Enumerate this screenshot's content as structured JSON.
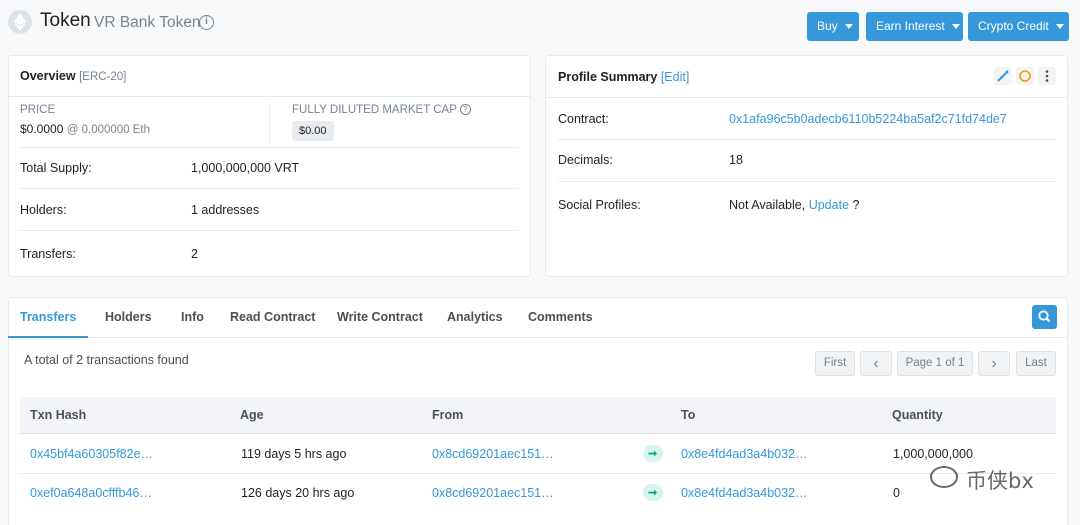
{
  "header": {
    "title": "Token",
    "subtitle": "VR Bank Token",
    "buttons": {
      "buy": "Buy",
      "earn": "Earn Interest",
      "credit": "Crypto Credit"
    }
  },
  "overview": {
    "title": "Overview",
    "standard": "[ERC-20]",
    "price_label": "PRICE",
    "price_value": "$0.0000",
    "price_eth": "@ 0.000000 Eth",
    "mcap_label": "FULLY DILUTED MARKET CAP",
    "mcap_value": "$0.00",
    "rows": [
      {
        "label": "Total Supply:",
        "value": "1,000,000,000 VRT"
      },
      {
        "label": "Holders:",
        "value": "1 addresses"
      },
      {
        "label": "Transfers:",
        "value": "2"
      }
    ]
  },
  "profile": {
    "title": "Profile Summary",
    "edit": "[Edit]",
    "contract_label": "Contract:",
    "contract_value": "0x1afa96c5b0adecb6110b5224ba5af2c71fd74de7",
    "decimals_label": "Decimals:",
    "decimals_value": "18",
    "social_label": "Social Profiles:",
    "social_value": "Not Available,",
    "social_update": "Update",
    "social_q": "?"
  },
  "tabs": [
    "Transfers",
    "Holders",
    "Info",
    "Read Contract",
    "Write Contract",
    "Analytics",
    "Comments"
  ],
  "summary": "A total of 2 transactions found",
  "pagination": {
    "first": "First",
    "prev": "‹",
    "page": "Page 1 of 1",
    "next": "›",
    "last": "Last"
  },
  "table": {
    "headers": [
      "Txn Hash",
      "Age",
      "From",
      "To",
      "Quantity"
    ],
    "rows": [
      {
        "hash": "0x45bf4a60305f82e…",
        "age": "119 days 5 hrs ago",
        "from": "0x8cd69201aec151…",
        "to": "0x8e4fd4ad3a4b032…",
        "qty": "1,000,000,000"
      },
      {
        "hash": "0xef0a648a0cfffb46…",
        "age": "126 days 20 hrs ago",
        "from": "0x8cd69201aec151…",
        "to": "0x8e4fd4ad3a4b032…",
        "qty": "0"
      }
    ]
  },
  "watermark": {
    "text": "币侠bx"
  },
  "colors": {
    "accent": "#3498db",
    "muted": "#77838f",
    "in_badge": "#00a186"
  }
}
